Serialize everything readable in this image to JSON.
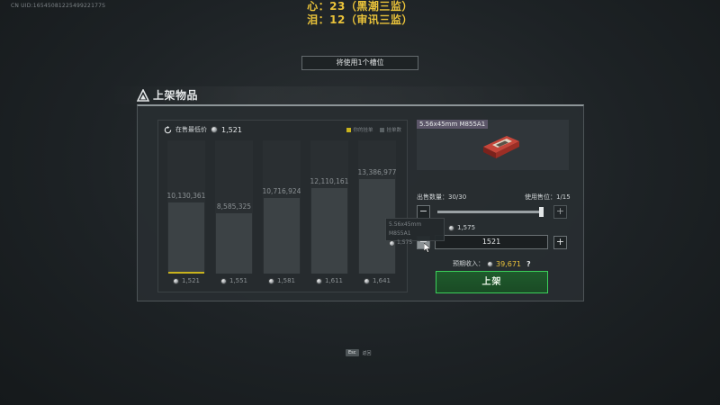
{
  "uid": "CN UID:1654508122549922177S",
  "status_lines": [
    "心：23（黑潮三监）",
    "泪：12（审讯三监）"
  ],
  "slot_banner": "将使用1个槽位",
  "section_title": "上架物品",
  "chart": {
    "lowest_label": "在售最低价",
    "lowest_value": "1,521",
    "legend_mine": "你的挂单",
    "legend_other": "挂单数"
  },
  "chart_data": {
    "type": "bar",
    "categories": [
      "1,521",
      "1,551",
      "1,581",
      "1,611",
      "1,641"
    ],
    "values": [
      10130361,
      8585325,
      10716924,
      12110161,
      13386977
    ],
    "value_labels": [
      "10,130,361",
      "8,585,325",
      "10,716,924",
      "12,110,161",
      "13,386,977"
    ],
    "highlighted_category": "1,521",
    "colors": {
      "bar": "#3c4245",
      "highlight": "#c9b31d"
    }
  },
  "item": {
    "name": "5.56x45mm M855A1"
  },
  "quantity": {
    "label": "出售数量：",
    "value": "30/30",
    "fraction": 1.0
  },
  "slots": {
    "label": "使用售位：",
    "value": "1/15"
  },
  "price": {
    "reference": "1,575",
    "input_value": "1521"
  },
  "income": {
    "label": "预期收入：",
    "value": "39,671",
    "help": "?"
  },
  "list_button": "上架",
  "tooltip": {
    "title": "5.56x45mm M855A1",
    "value": "1,575"
  },
  "esc": {
    "key": "Esc",
    "label": "返回"
  },
  "colors": {
    "accent_yellow": "#e9c23a",
    "list_green": "#3bd05a"
  }
}
